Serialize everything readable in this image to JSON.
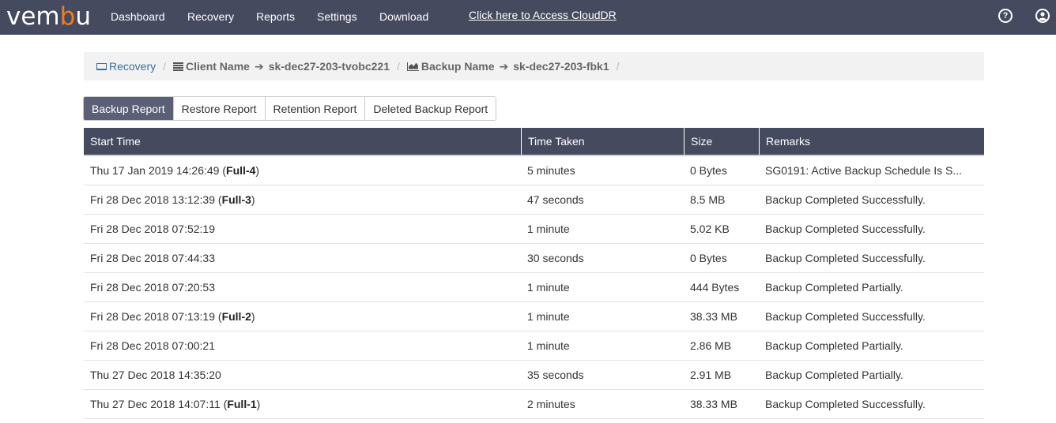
{
  "app": {
    "logo": {
      "part1": "vem",
      "part2": "b",
      "part3": "u"
    },
    "nav": [
      "Dashboard",
      "Recovery",
      "Reports",
      "Settings",
      "Download"
    ],
    "cloud_link": "Click here to Access CloudDR",
    "help_icon": "question-circle-icon",
    "user_icon": "user-circle-icon"
  },
  "breadcrumb": {
    "recovery": "Recovery",
    "client_label": "Client Name",
    "client_value": "sk-dec27-203-tvobc221",
    "backup_label": "Backup Name",
    "backup_value": "sk-dec27-203-fbk1"
  },
  "tabs": [
    "Backup Report",
    "Restore Report",
    "Retention Report",
    "Deleted Backup Report"
  ],
  "active_tab": "Backup Report",
  "table": {
    "headers": [
      "Start Time",
      "Time Taken",
      "Size",
      "Remarks"
    ],
    "rows": [
      {
        "start": "Thu 17 Jan 2019 14:26:49",
        "tag": "Full-4",
        "taken": "5 minutes",
        "size": "0 Bytes",
        "remarks": "SG0191: Active Backup Schedule Is S..."
      },
      {
        "start": "Fri 28 Dec 2018 13:12:39",
        "tag": "Full-3",
        "taken": "47 seconds",
        "size": "8.5 MB",
        "remarks": "Backup Completed Successfully."
      },
      {
        "start": "Fri 28 Dec 2018 07:52:19",
        "tag": "",
        "taken": "1 minute",
        "size": "5.02 KB",
        "remarks": "Backup Completed Successfully."
      },
      {
        "start": "Fri 28 Dec 2018 07:44:33",
        "tag": "",
        "taken": "30 seconds",
        "size": "0 Bytes",
        "remarks": "Backup Completed Successfully."
      },
      {
        "start": "Fri 28 Dec 2018 07:20:53",
        "tag": "",
        "taken": "1 minute",
        "size": "444 Bytes",
        "remarks": "Backup Completed Partially."
      },
      {
        "start": "Fri 28 Dec 2018 07:13:19",
        "tag": "Full-2",
        "taken": "1 minute",
        "size": "38.33 MB",
        "remarks": "Backup Completed Successfully."
      },
      {
        "start": "Fri 28 Dec 2018 07:00:21",
        "tag": "",
        "taken": "1 minute",
        "size": "2.86 MB",
        "remarks": "Backup Completed Partially."
      },
      {
        "start": "Thu 27 Dec 2018 14:35:20",
        "tag": "",
        "taken": "35 seconds",
        "size": "2.91 MB",
        "remarks": "Backup Completed Partially."
      },
      {
        "start": "Thu 27 Dec 2018 14:07:11",
        "tag": "Full-1",
        "taken": "2 minutes",
        "size": "38.33 MB",
        "remarks": "Backup Completed Successfully."
      }
    ]
  },
  "colors": {
    "header_bg": "#454a5e",
    "accent": "#f47c20",
    "link": "#3a6f9e"
  }
}
